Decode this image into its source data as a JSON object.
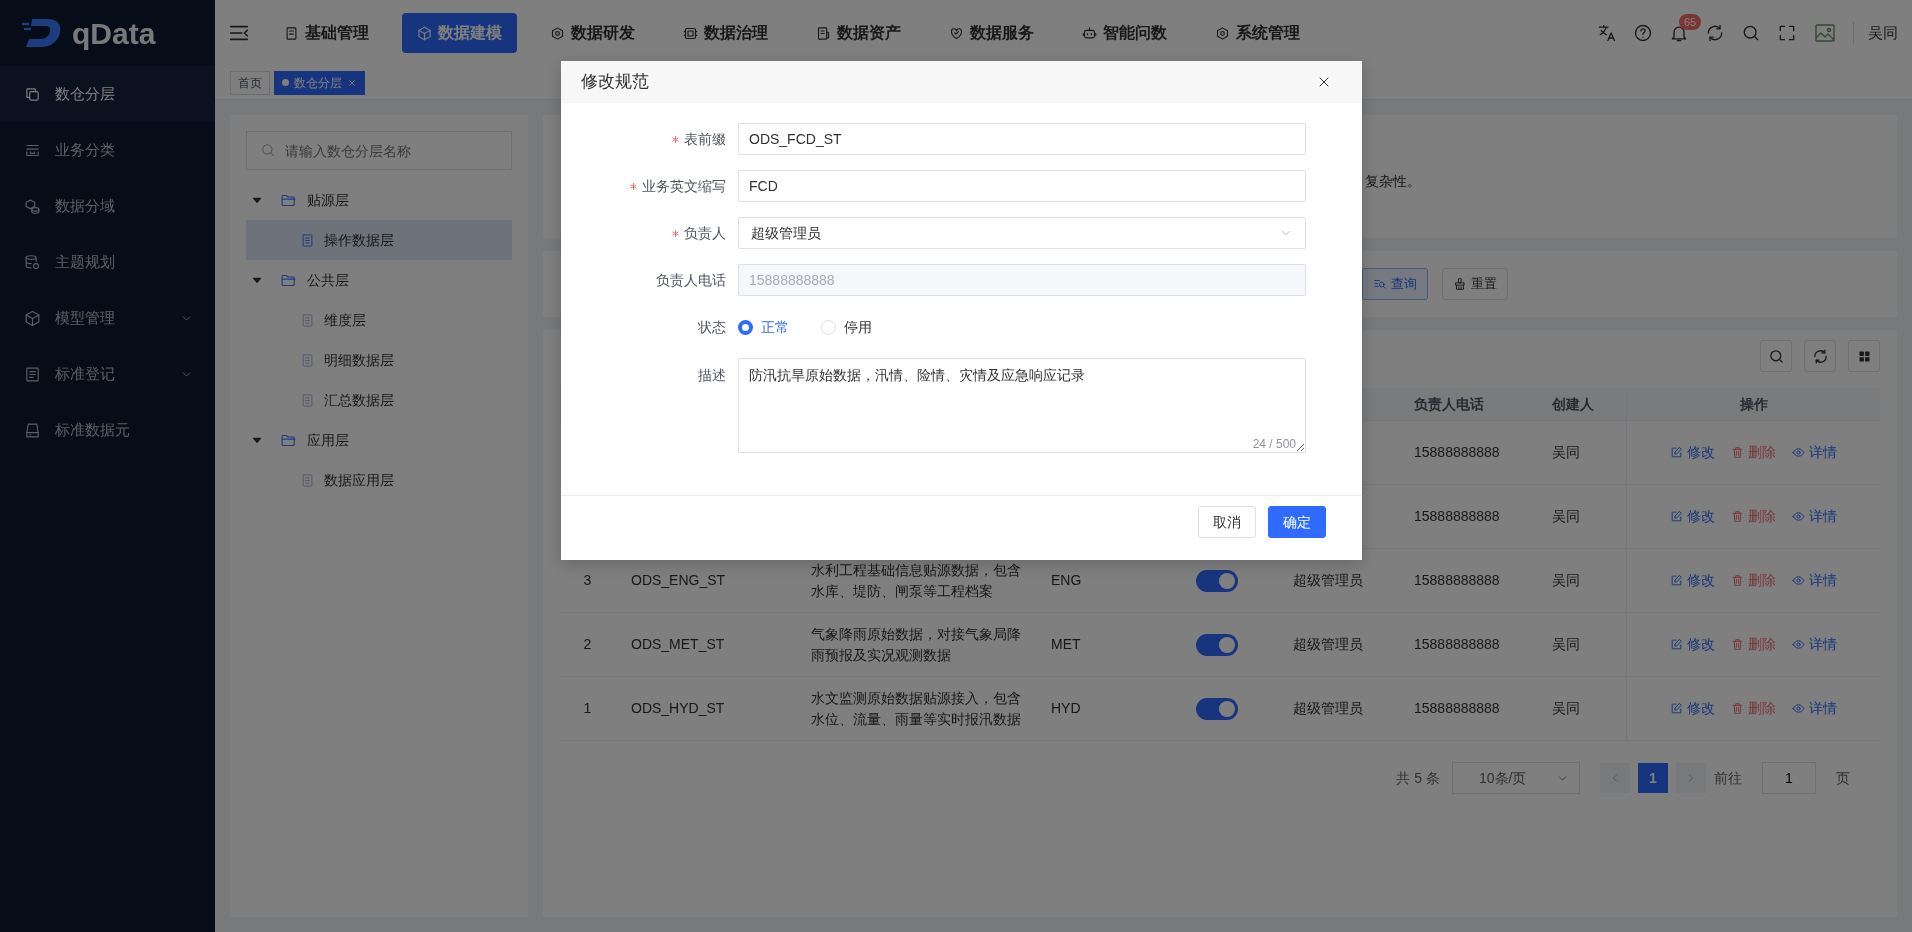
{
  "sidebar": {
    "logo": "qData",
    "items": [
      {
        "label": "数仓分层",
        "selected": true,
        "has_submenu": false
      },
      {
        "label": "业务分类",
        "selected": false,
        "has_submenu": false
      },
      {
        "label": "数据分域",
        "selected": false,
        "has_submenu": false
      },
      {
        "label": "主题规划",
        "selected": false,
        "has_submenu": false
      },
      {
        "label": "模型管理",
        "selected": false,
        "has_submenu": true
      },
      {
        "label": "标准登记",
        "selected": false,
        "has_submenu": true
      },
      {
        "label": "标准数据元",
        "selected": false,
        "has_submenu": false
      }
    ]
  },
  "topbar": {
    "nav": [
      {
        "label": "基础管理",
        "selected": false
      },
      {
        "label": "数据建模",
        "selected": true
      },
      {
        "label": "数据研发",
        "selected": false
      },
      {
        "label": "数据治理",
        "selected": false
      },
      {
        "label": "数据资产",
        "selected": false
      },
      {
        "label": "数据服务",
        "selected": false
      },
      {
        "label": "智能问数",
        "selected": false
      },
      {
        "label": "系统管理",
        "selected": false
      }
    ],
    "notification_count": "65",
    "user": "吴同"
  },
  "tabs": [
    {
      "label": "首页",
      "selected": false,
      "closable": false
    },
    {
      "label": "数仓分层",
      "selected": true,
      "closable": true
    }
  ],
  "tree": {
    "placeholder": "请输入数仓分层名称",
    "nodes": [
      {
        "label": "贴源层",
        "expanded": true,
        "selected": false,
        "children": [
          {
            "label": "操作数据层",
            "selected": true
          }
        ]
      },
      {
        "label": "公共层",
        "expanded": true,
        "selected": false,
        "children": [
          {
            "label": "维度层",
            "selected": false
          },
          {
            "label": "明细数据层",
            "selected": false
          },
          {
            "label": "汇总数据层",
            "selected": false
          }
        ]
      },
      {
        "label": "应用层",
        "expanded": true,
        "selected": false,
        "children": [
          {
            "label": "数据应用层",
            "selected": false
          }
        ]
      }
    ]
  },
  "info_card": {
    "text": "复杂性。"
  },
  "search_form": {
    "buttons": [
      {
        "label": "查询",
        "kind": "primary"
      },
      {
        "label": "重置",
        "kind": "default"
      }
    ]
  },
  "table": {
    "columns": [
      "负责人电话",
      "创建人",
      "操作"
    ],
    "rows": [
      {
        "phone": "15888888888",
        "creator": "吴同",
        "actions": [
          {
            "label": "修改",
            "kind": "edit"
          },
          {
            "label": "删除",
            "kind": "delete"
          },
          {
            "label": "详情",
            "kind": "view"
          }
        ]
      },
      {
        "phone": "15888888888",
        "creator": "吴同",
        "actions": [
          {
            "label": "修改",
            "kind": "edit"
          },
          {
            "label": "删除",
            "kind": "delete"
          },
          {
            "label": "详情",
            "kind": "view"
          }
        ]
      },
      {
        "index": "3",
        "name": "ODS_ENG_ST",
        "description": "水利工程基础信息贴源数据，包含水库、堤防、闸泵等工程档案",
        "abbreviation": "ENG",
        "status_on": true,
        "owner": "超级管理员",
        "phone": "15888888888",
        "creator": "吴同",
        "actions": [
          {
            "label": "修改",
            "kind": "edit"
          },
          {
            "label": "删除",
            "kind": "delete"
          },
          {
            "label": "详情",
            "kind": "view"
          }
        ]
      },
      {
        "index": "2",
        "name": "ODS_MET_ST",
        "description": "气象降雨原始数据，对接气象局降雨预报及实况观测数据",
        "abbreviation": "MET",
        "status_on": true,
        "owner": "超级管理员",
        "phone": "15888888888",
        "creator": "吴同",
        "actions": [
          {
            "label": "修改",
            "kind": "edit"
          },
          {
            "label": "删除",
            "kind": "delete"
          },
          {
            "label": "详情",
            "kind": "view"
          }
        ]
      },
      {
        "index": "1",
        "name": "ODS_HYD_ST",
        "description": "水文监测原始数据贴源接入，包含水位、流量、雨量等实时报汛数据",
        "abbreviation": "HYD",
        "status_on": true,
        "owner": "超级管理员",
        "phone": "15888888888",
        "creator": "吴同",
        "actions": [
          {
            "label": "修改",
            "kind": "edit"
          },
          {
            "label": "删除",
            "kind": "delete"
          },
          {
            "label": "详情",
            "kind": "view"
          }
        ]
      }
    ]
  },
  "pagination": {
    "total": "共 5 条",
    "page_size": "10条/页",
    "pages": [
      {
        "label": "1",
        "selected": true
      }
    ],
    "goto_label": "前往",
    "goto_value": "1",
    "goto_suffix": "页"
  },
  "dialog": {
    "title": "修改规范",
    "fields": [
      {
        "kind": "text",
        "label": "表前缀",
        "required": true,
        "disabled": false,
        "value": "ODS_FCD_ST"
      },
      {
        "kind": "text",
        "label": "业务英文缩写",
        "required": true,
        "disabled": false,
        "value": "FCD"
      },
      {
        "kind": "select",
        "label": "负责人",
        "required": true,
        "value": "超级管理员"
      },
      {
        "kind": "text",
        "label": "负责人电话",
        "required": false,
        "disabled": true,
        "value": "15888888888"
      },
      {
        "kind": "radio",
        "label": "状态",
        "required": false,
        "options": [
          {
            "label": "正常",
            "selected": true
          },
          {
            "label": "停用",
            "selected": false
          }
        ]
      },
      {
        "kind": "textarea",
        "label": "描述",
        "required": false,
        "value": "防汛抗旱原始数据，汛情、险情、灾情及应急响应记录",
        "counter": "24 / 500"
      }
    ],
    "buttons": [
      {
        "label": "取消",
        "kind": "default"
      },
      {
        "label": "确定",
        "kind": "primary"
      }
    ]
  }
}
